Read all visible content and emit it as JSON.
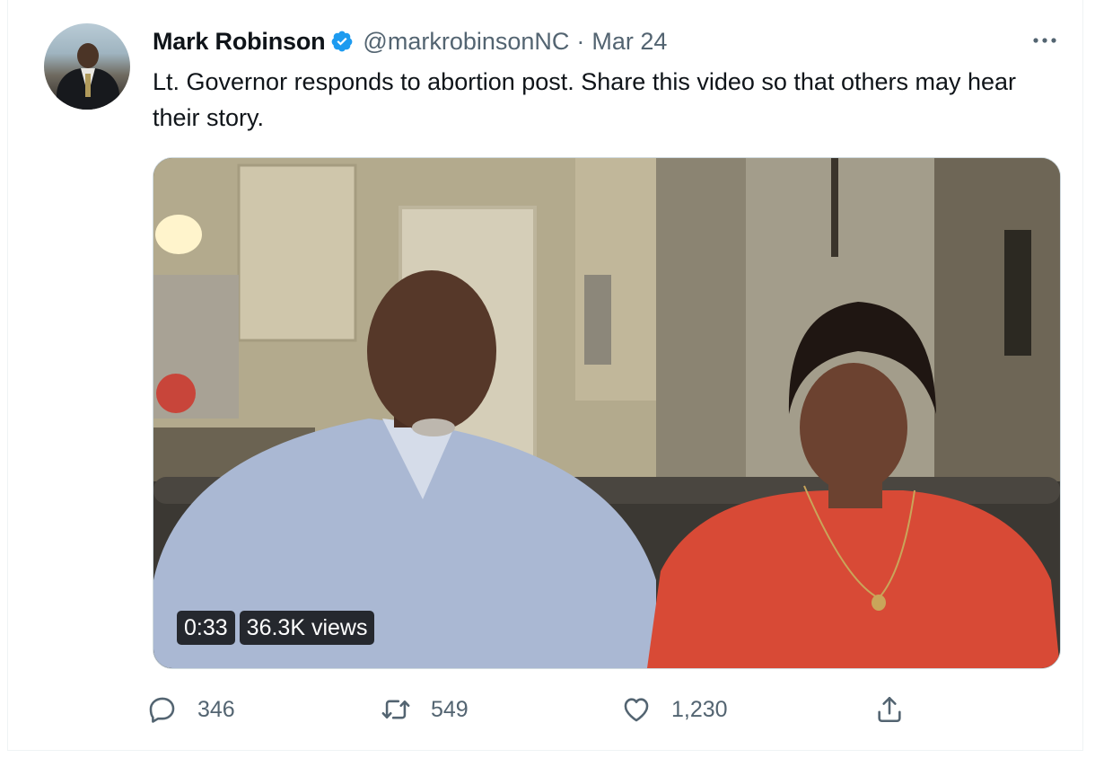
{
  "tweet": {
    "author_name": "Mark Robinson",
    "verified_icon": "verified-badge-icon",
    "handle": "@markrobinsonNC",
    "separator": "·",
    "date": "Mar 24",
    "more_icon": "more-icon",
    "text": "Lt. Governor responds to abortion post. Share this video so that others may hear their story."
  },
  "media": {
    "type": "video",
    "duration": "0:33",
    "views": "36.3K views"
  },
  "actions": {
    "reply": {
      "icon": "reply-icon",
      "count": "346"
    },
    "retweet": {
      "icon": "retweet-icon",
      "count": "549"
    },
    "like": {
      "icon": "like-icon",
      "count": "1,230"
    },
    "share": {
      "icon": "share-icon"
    }
  },
  "colors": {
    "text": "#0f1419",
    "secondary": "#536471",
    "verified": "#1d9bf0",
    "border": "#cfd9de"
  }
}
